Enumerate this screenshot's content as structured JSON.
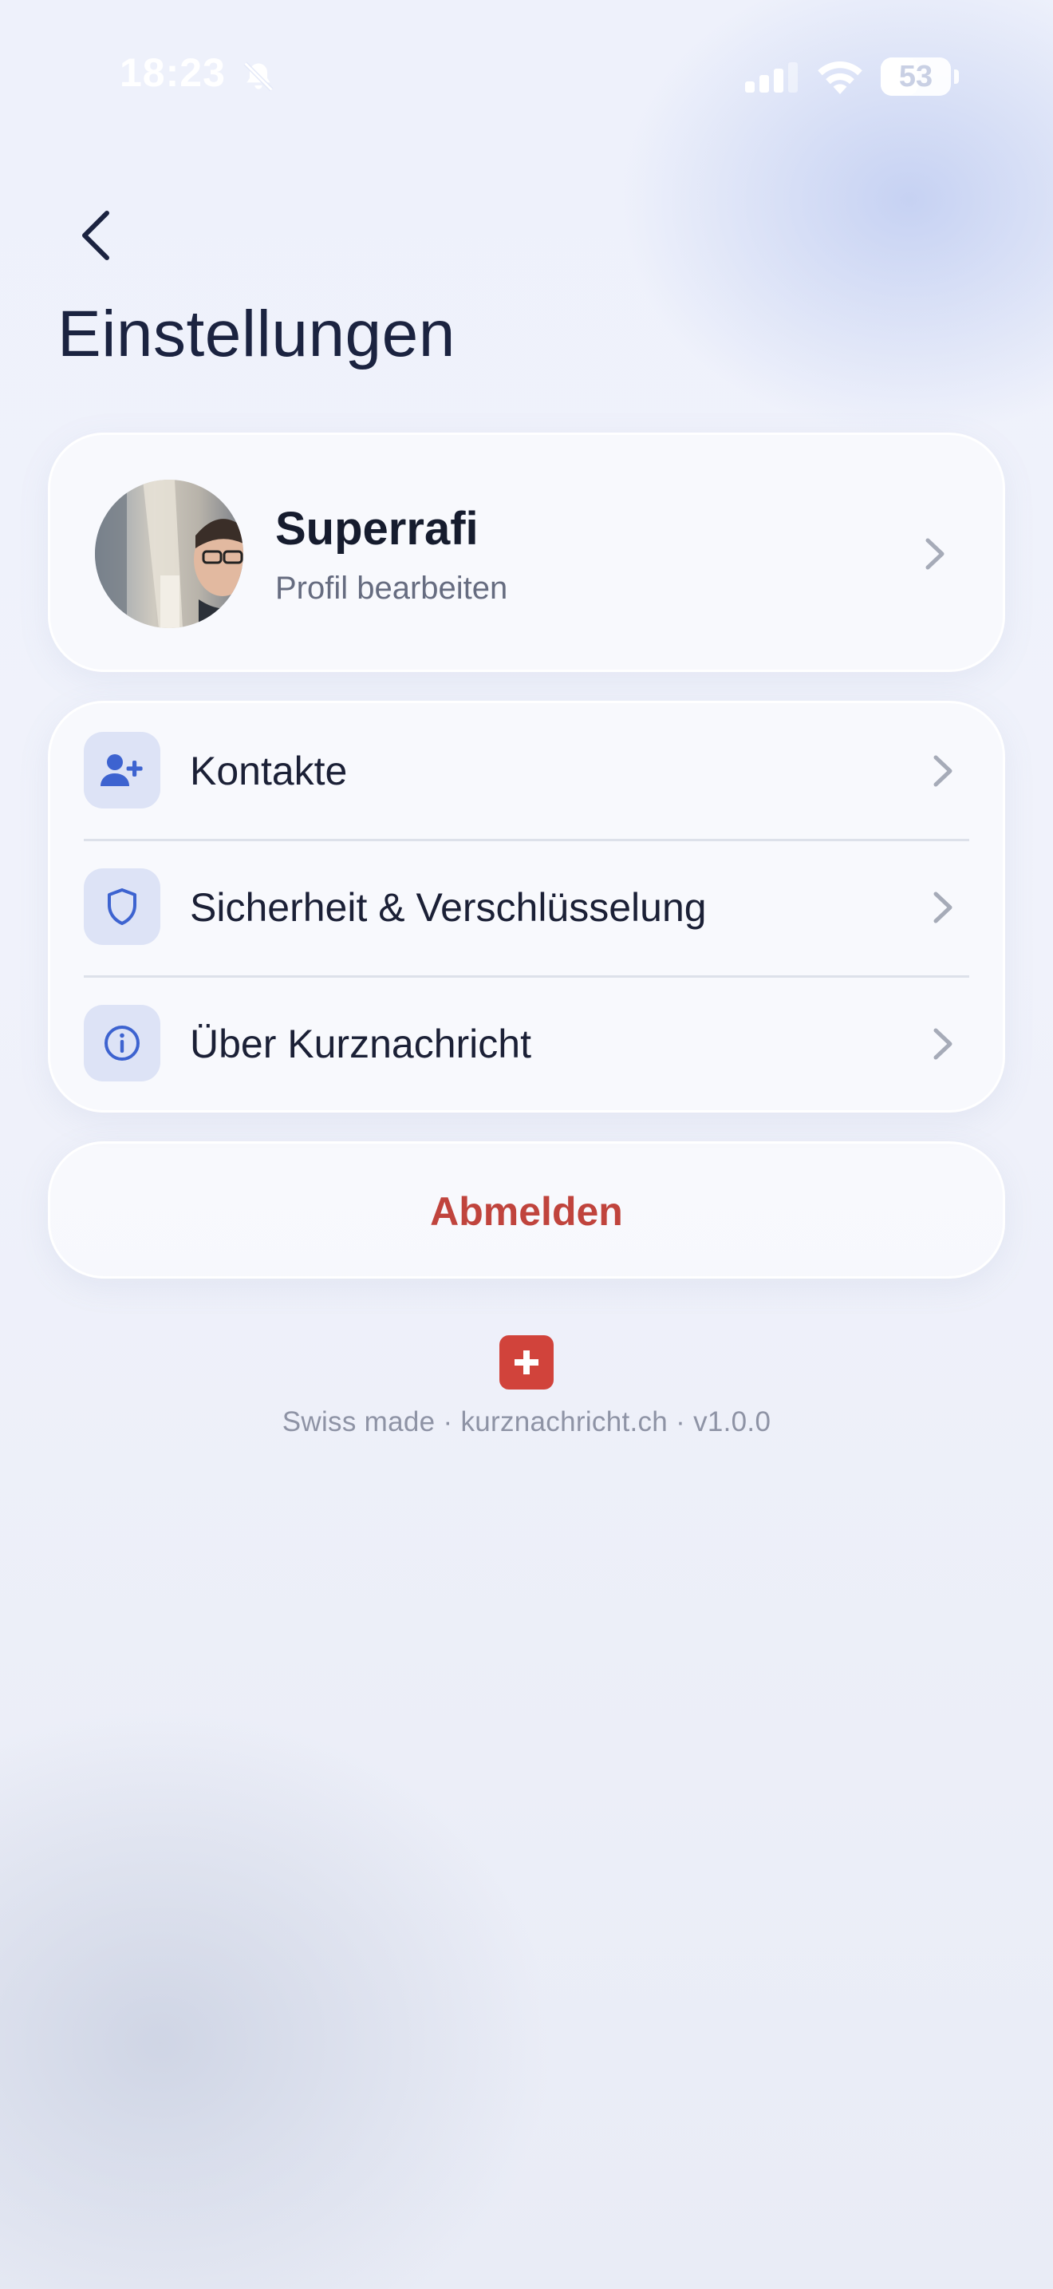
{
  "status_bar": {
    "time": "18:23",
    "battery": "53",
    "battery_level": 0.53
  },
  "header": {
    "title": "Einstellungen"
  },
  "profile": {
    "name": "Superrafi",
    "subtitle": "Profil bearbeiten"
  },
  "menu": {
    "items": [
      {
        "label": "Kontakte",
        "icon": "add-contact-icon"
      },
      {
        "label": "Sicherheit & Verschlüsselung",
        "icon": "shield-icon"
      },
      {
        "label": "Über Kurznachricht",
        "icon": "info-icon"
      }
    ]
  },
  "logout": {
    "label": "Abmelden"
  },
  "footer": {
    "text": "Swiss made · kurznachricht.ch · v1.0.0"
  },
  "colors": {
    "accent": "#3d63d0",
    "destructive": "#c0443d",
    "icon_background": "#dde3f6"
  }
}
